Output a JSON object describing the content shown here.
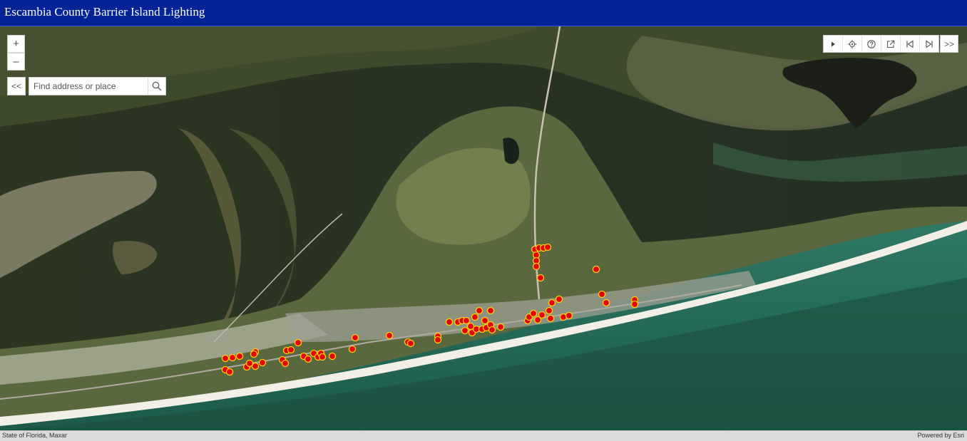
{
  "app": {
    "title": "Escambia County Barrier Island Lighting"
  },
  "map_controls": {
    "zoom_in": "+",
    "zoom_out": "–",
    "collapse": "<<",
    "expand": ">>"
  },
  "search": {
    "placeholder": "Find address or place",
    "icon": "search-icon"
  },
  "toolbar": {
    "items": [
      {
        "name": "play",
        "icon": "play-icon"
      },
      {
        "name": "locate",
        "icon": "locate-icon"
      },
      {
        "name": "help",
        "icon": "help-icon"
      },
      {
        "name": "share",
        "icon": "share-icon"
      },
      {
        "name": "previous-extent",
        "icon": "previous-extent-icon"
      },
      {
        "name": "next-extent",
        "icon": "next-extent-icon"
      }
    ]
  },
  "attribution": {
    "left": "State of Florida, Maxar",
    "right": "Powered by Esri"
  },
  "colors": {
    "header": "#002496",
    "marker_fill": "#e10000",
    "marker_stroke": "#ffd200"
  }
}
